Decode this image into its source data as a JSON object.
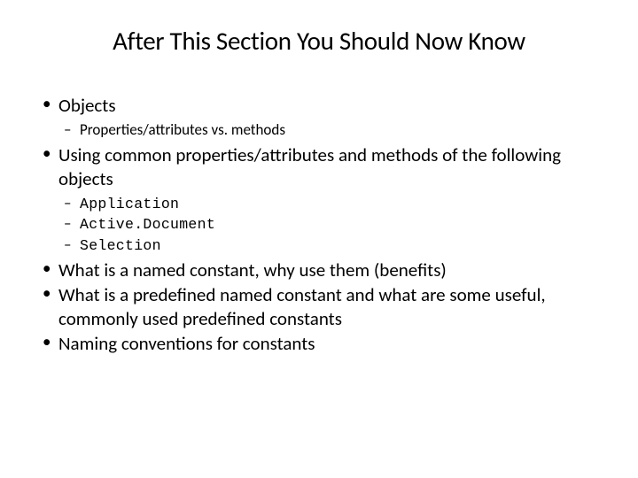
{
  "title": "After This Section You Should Now Know",
  "bullets": {
    "b0": "Objects",
    "b0s0": "Properties/attributes vs. methods",
    "b1": "Using common properties/attributes and methods of the following objects",
    "b1s0": "Application",
    "b1s1": "Active.Document",
    "b1s2": "Selection",
    "b2": "What is a named constant, why use them (benefits)",
    "b3": "What is a predefined named constant and what are some useful, commonly used predefined constants",
    "b4": "Naming conventions for constants"
  }
}
